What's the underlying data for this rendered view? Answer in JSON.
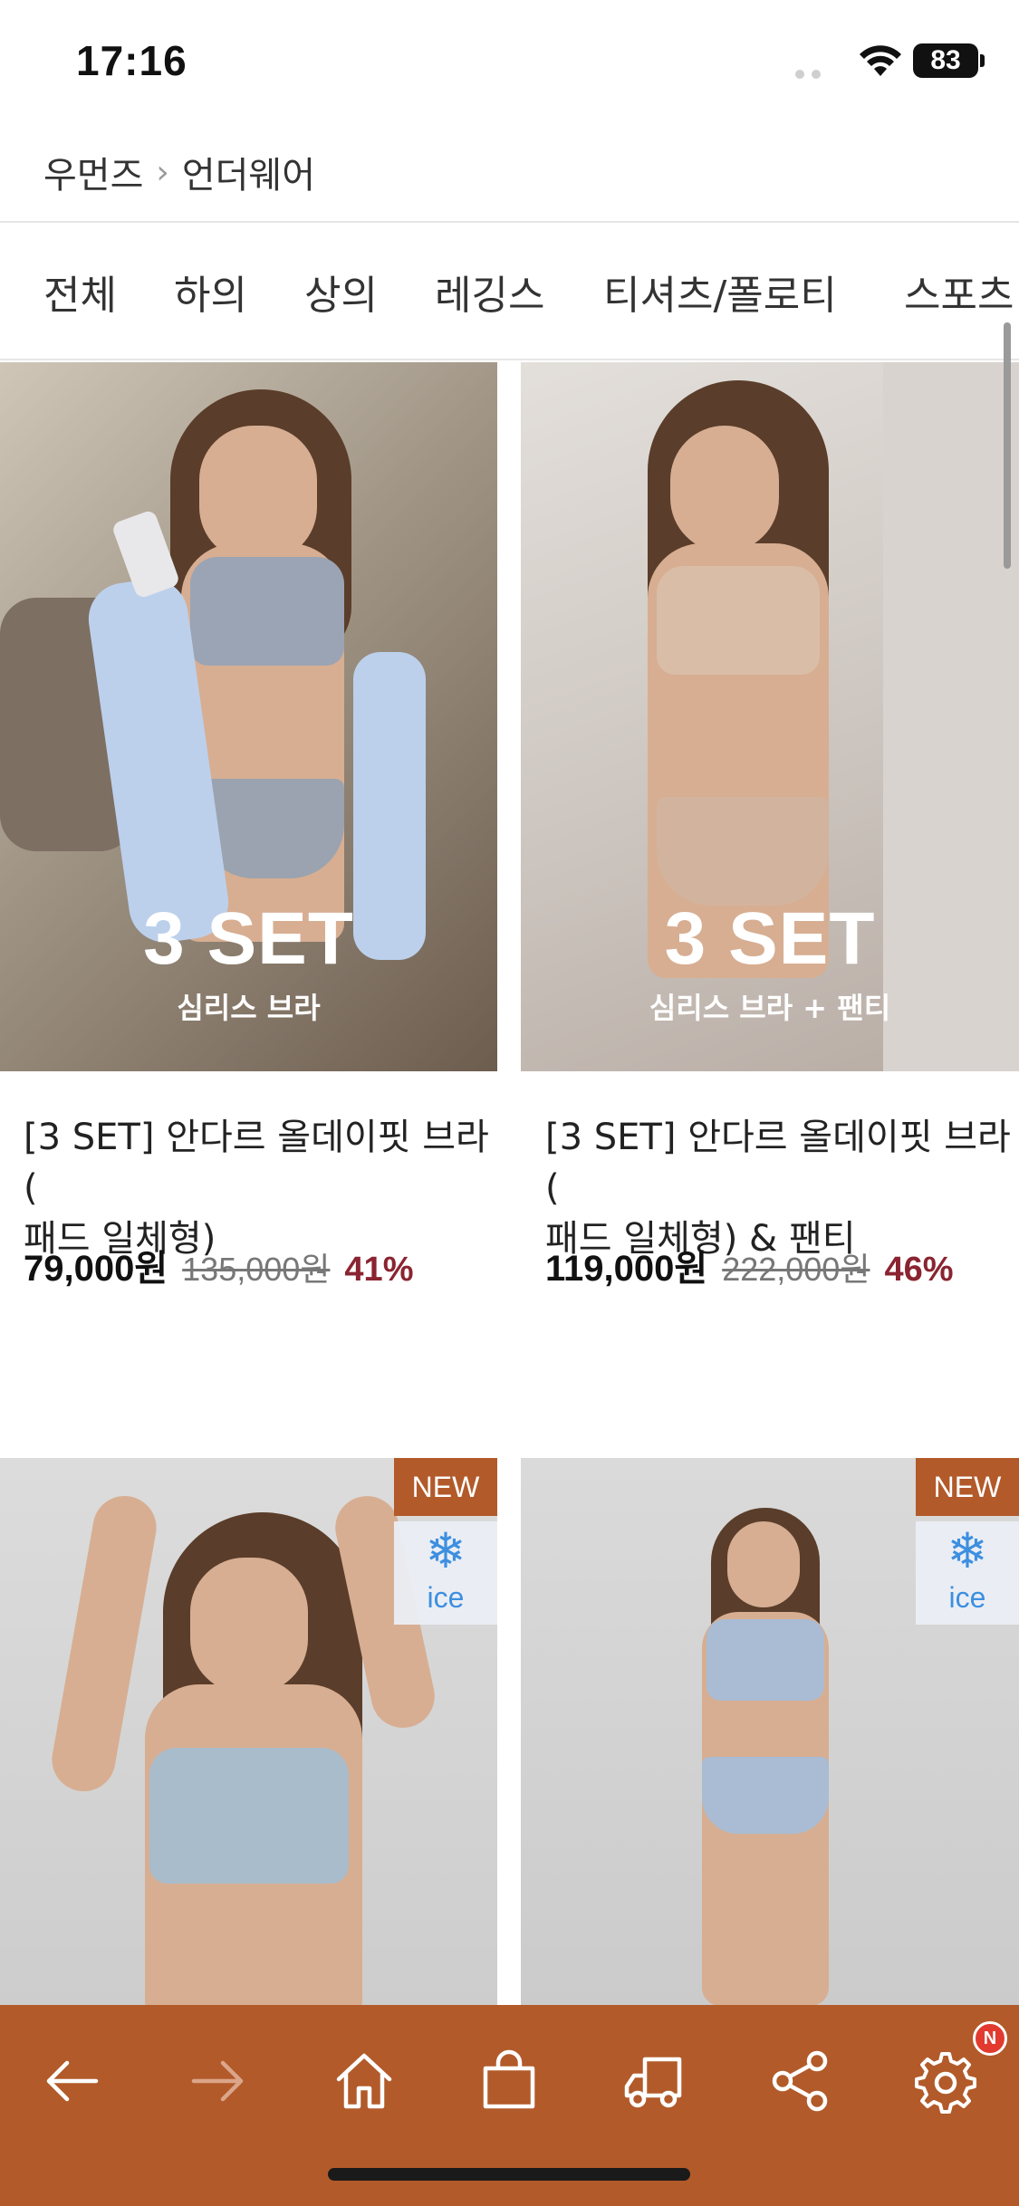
{
  "status_bar": {
    "time": "17:16",
    "battery": "83"
  },
  "breadcrumb": {
    "parent": "우먼즈",
    "separator": "›",
    "current": "언더웨어"
  },
  "tabs": [
    "전체",
    "하의",
    "상의",
    "레깅스",
    "티셔츠/폴로티",
    "스포츠"
  ],
  "products": [
    {
      "overlay_title": "3 SET",
      "overlay_subtitle": "심리스 브라",
      "name_line1": "[3 SET] 안다르 올데이핏 브라 (",
      "name_line2": "패드 일체형)",
      "price": "79,000원",
      "original_price": "135,000원",
      "discount": "41%"
    },
    {
      "overlay_title": "3 SET",
      "overlay_subtitle": "심리스 브라 + 팬티",
      "name_line1": "[3 SET] 안다르 올데이핏 브라 (",
      "name_line2": "패드 일체형) & 팬티",
      "price": "119,000원",
      "original_price": "222,000원",
      "discount": "46%"
    },
    {
      "badge_new": "NEW",
      "badge_ice": "ice"
    },
    {
      "badge_new": "NEW",
      "badge_ice": "ice"
    }
  ],
  "bottom_nav": {
    "icons": [
      "back-arrow-icon",
      "forward-arrow-icon",
      "home-icon",
      "shopping-bag-icon",
      "delivery-truck-icon",
      "share-icon",
      "settings-gear-icon"
    ],
    "notification_badge": "N"
  },
  "colors": {
    "brand": "#b25a2a",
    "discount": "#8a2430",
    "ice_blue": "#3d8fe0"
  }
}
